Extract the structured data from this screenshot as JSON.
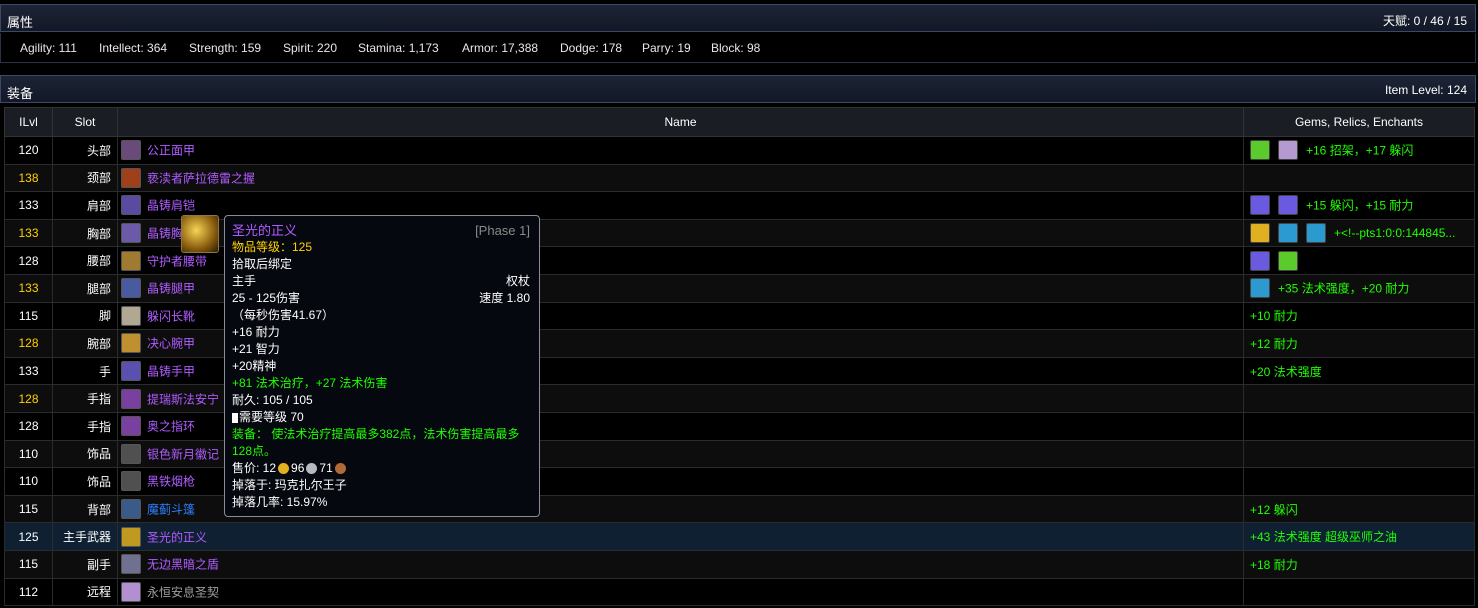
{
  "attributes": {
    "title": "属性",
    "talent": "天赋: 0 / 46 / 15",
    "stats": [
      "Agility: 111",
      "Intellect: 364",
      "Strength: 159",
      "Spirit: 220",
      "Stamina: 1,173",
      "Armor: 17,388",
      "Dodge: 178",
      "Parry: 19",
      "Block: 98"
    ]
  },
  "equipment": {
    "title": "装备",
    "item_level": "Item Level: 124",
    "columns": [
      "ILvl",
      "Slot",
      "Name",
      "Gems, Relics, Enchants"
    ],
    "rows": [
      {
        "ilvl": "120",
        "slot": "头部",
        "name": "公正面甲",
        "quality": "epic",
        "enchant": "+16 招架，+17 躲闪",
        "icon": "helmet-icon",
        "gems": [
          "green-gem",
          "meta-gem"
        ]
      },
      {
        "ilvl": "138",
        "slot": "颈部",
        "name": "亵渎者萨拉德雷之握",
        "quality": "epic",
        "enchant": "",
        "icon": "necklace-icon",
        "gems": []
      },
      {
        "ilvl": "133",
        "slot": "肩部",
        "name": "晶铸肩铠",
        "quality": "epic",
        "enchant": "+15 躲闪，+15 耐力",
        "icon": "shoulder-icon",
        "gems": [
          "purple-gem",
          "purple-gem"
        ]
      },
      {
        "ilvl": "133",
        "slot": "胸部",
        "name": "晶铸胸甲",
        "quality": "epic",
        "enchant": "+<!--pts1:0:0:144845...",
        "icon": "chest-icon",
        "gems": [
          "yellow-gem",
          "blue-gem",
          "blue-gem"
        ]
      },
      {
        "ilvl": "128",
        "slot": "腰部",
        "name": "守护者腰带",
        "quality": "epic",
        "enchant": "",
        "icon": "belt-icon",
        "gems": [
          "purple-gem",
          "green-gem"
        ]
      },
      {
        "ilvl": "133",
        "slot": "腿部",
        "name": "晶铸腿甲",
        "quality": "epic",
        "enchant": "+35 法术强度，+20 耐力",
        "icon": "legs-icon",
        "gems": [
          "blue-gem"
        ]
      },
      {
        "ilvl": "115",
        "slot": "脚",
        "name": "躲闪长靴",
        "quality": "epic",
        "enchant": "+10 耐力",
        "icon": "boots-icon",
        "gems": []
      },
      {
        "ilvl": "128",
        "slot": "腕部",
        "name": "决心腕甲",
        "quality": "epic",
        "enchant": "+12 耐力",
        "icon": "bracers-icon",
        "gems": []
      },
      {
        "ilvl": "133",
        "slot": "手",
        "name": "晶铸手甲",
        "quality": "epic",
        "enchant": "+20 法术强度",
        "icon": "gloves-icon",
        "gems": []
      },
      {
        "ilvl": "128",
        "slot": "手指",
        "name": "提瑞斯法安宁",
        "quality": "epic",
        "enchant": "",
        "icon": "ring-icon",
        "gems": []
      },
      {
        "ilvl": "128",
        "slot": "手指",
        "name": "奥之指环",
        "quality": "epic",
        "enchant": "",
        "icon": "ring-icon",
        "gems": []
      },
      {
        "ilvl": "110",
        "slot": "饰品",
        "name": "银色新月徽记",
        "quality": "epic",
        "enchant": "",
        "icon": "trinket-icon",
        "gems": []
      },
      {
        "ilvl": "110",
        "slot": "饰品",
        "name": "黑铁烟枪",
        "quality": "epic",
        "enchant": "",
        "icon": "trinket-icon",
        "gems": []
      },
      {
        "ilvl": "115",
        "slot": "背部",
        "name": "魔蓟斗篷",
        "quality": "rare",
        "enchant": "+12 躲闪",
        "icon": "cloak-icon",
        "gems": []
      },
      {
        "ilvl": "125",
        "slot": "主手武器",
        "name": "圣光的正义",
        "quality": "epic",
        "enchant": "+43 法术强度 超级巫师之油",
        "icon": "mace-icon",
        "gems": []
      },
      {
        "ilvl": "115",
        "slot": "副手",
        "name": "无边黑暗之盾",
        "quality": "epic",
        "enchant": "+18 耐力",
        "icon": "shield-icon",
        "gems": []
      },
      {
        "ilvl": "112",
        "slot": "远程",
        "name": "永恒安息圣契",
        "quality": "poor",
        "enchant": "",
        "icon": "libram-icon",
        "gems": []
      }
    ]
  },
  "tooltip": {
    "name": "圣光的正义",
    "phase": "[Phase 1]",
    "item_level": "物品等级：125",
    "bind": "拾取后绑定",
    "slot": "主手",
    "type": "权杖",
    "damage": "25 - 125伤害",
    "speed": "速度 1.80",
    "dps": "（每秒伤害41.67）",
    "stat1": "+16 耐力",
    "stat2": "+21 智力",
    "stat3": "+20精神",
    "bonus": "+81 法术治疗，+27 法术伤害",
    "durability": "耐久: 105 / 105",
    "required": "需要等级 70",
    "equip1": "装备：  使法术治疗提高最多382点，法术伤害提高最多",
    "equip2": "128点。",
    "sell_label": "售价: 12",
    "sell_silver": "96",
    "sell_copper": "71",
    "dropped_by": "掉落于: 玛克扎尔王子",
    "drop_rate": "掉落几率: 15.97%"
  }
}
